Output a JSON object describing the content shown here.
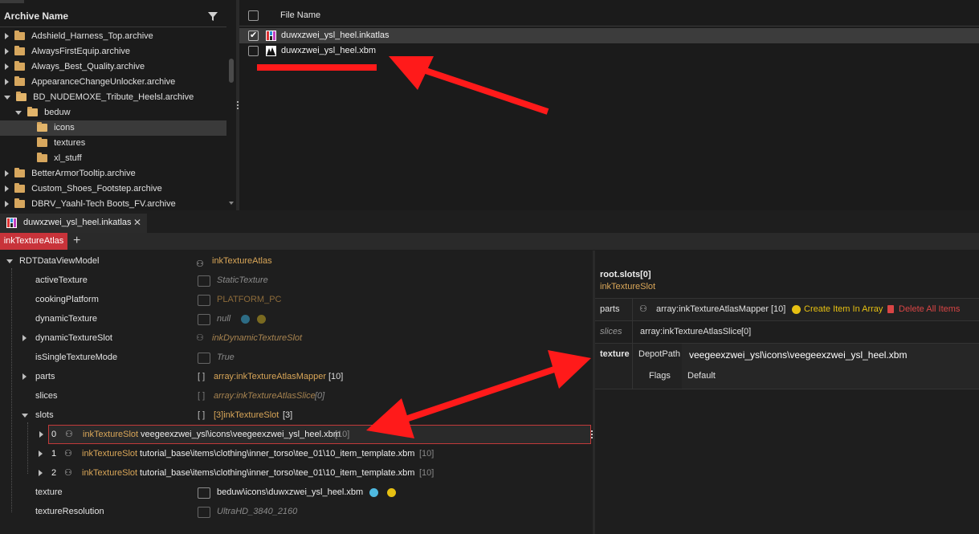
{
  "archive_panel": {
    "header": "Archive Name",
    "items": [
      {
        "label": "Adshield_Harness_Top.archive"
      },
      {
        "label": "AlwaysFirstEquip.archive"
      },
      {
        "label": "Always_Best_Quality.archive"
      },
      {
        "label": "AppearanceChangeUnlocker.archive"
      },
      {
        "label": "BD_NUDEMOXE_Tribute_Heelsl.archive"
      },
      {
        "label": "beduw"
      },
      {
        "label": "icons"
      },
      {
        "label": "textures"
      },
      {
        "label": "xl_stuff"
      },
      {
        "label": "BetterArmorTooltip.archive"
      },
      {
        "label": "Custom_Shoes_Footstep.archive"
      },
      {
        "label": "DBRV_Yaahl-Tech Boots_FV.archive"
      }
    ]
  },
  "file_panel": {
    "header": "File Name",
    "files": [
      {
        "name": "duwxzwei_ysl_heel.inkatlas",
        "checked": true
      },
      {
        "name": "duwxzwei_ysl_heel.xbm",
        "checked": false
      }
    ]
  },
  "tabs": {
    "doc_tab": "duwxzwei_ysl_heel.inkatlas",
    "close": "✕",
    "sub_tab": "inkTextureAtlas",
    "add": "+"
  },
  "property_tree": {
    "root": {
      "name": "RDTDataViewModel",
      "type": "inkTextureAtlas"
    },
    "rows": [
      {
        "name": "activeTexture",
        "value": "StaticTexture"
      },
      {
        "name": "cookingPlatform",
        "value": "PLATFORM_PC"
      },
      {
        "name": "dynamicTexture",
        "value": "null"
      },
      {
        "name": "dynamicTextureSlot",
        "value": "inkDynamicTextureSlot"
      },
      {
        "name": "isSingleTextureMode",
        "value": "True"
      },
      {
        "name": "parts",
        "value": "array:inkTextureAtlasMapper",
        "count": "[10]"
      },
      {
        "name": "slices",
        "value": "array:inkTextureAtlasSlice",
        "count": "[0]"
      },
      {
        "name": "slots",
        "value": "[3]inkTextureSlot",
        "count": "[3]"
      },
      {
        "name": "texture",
        "value": "beduw\\icons\\duwxzwei_ysl_heel.xbm"
      },
      {
        "name": "textureResolution",
        "value": "UltraHD_3840_2160"
      }
    ],
    "slots": [
      {
        "index": "0",
        "type": "inkTextureSlot",
        "path": "veegeexzwei_ysl\\icons\\veegeexzwei_ysl_heel.xbm",
        "count": "[10]"
      },
      {
        "index": "1",
        "type": "inkTextureSlot",
        "path": "tutorial_base\\items\\clothing\\inner_torso\\tee_01\\10_item_template.xbm",
        "count": "[10]"
      },
      {
        "index": "2",
        "type": "inkTextureSlot",
        "path": "tutorial_base\\items\\clothing\\inner_torso\\tee_01\\10_item_template.xbm",
        "count": "[10]"
      }
    ]
  },
  "detail_panel": {
    "path": "root.slots[0]",
    "type": "inkTextureSlot",
    "parts_label": "parts",
    "parts_value": "array:inkTextureAtlasMapper",
    "parts_count": "[10]",
    "create_item": "Create Item In Array",
    "delete_all": "Delete All Items",
    "slices_label": "slices",
    "slices_value": "array:inkTextureAtlasSlice",
    "slices_count": "[0]",
    "texture_label": "texture",
    "depot_label": "DepotPath",
    "depot_value": "veegeexzwei_ysl\\icons\\veegeexzwei_ysl_heel.xbm",
    "flags_label": "Flags",
    "flags_value": "Default"
  },
  "colors": {
    "accent_red": "#c8333a",
    "type_orange": "#d9a658",
    "annotation_red": "#ff1a1a"
  }
}
